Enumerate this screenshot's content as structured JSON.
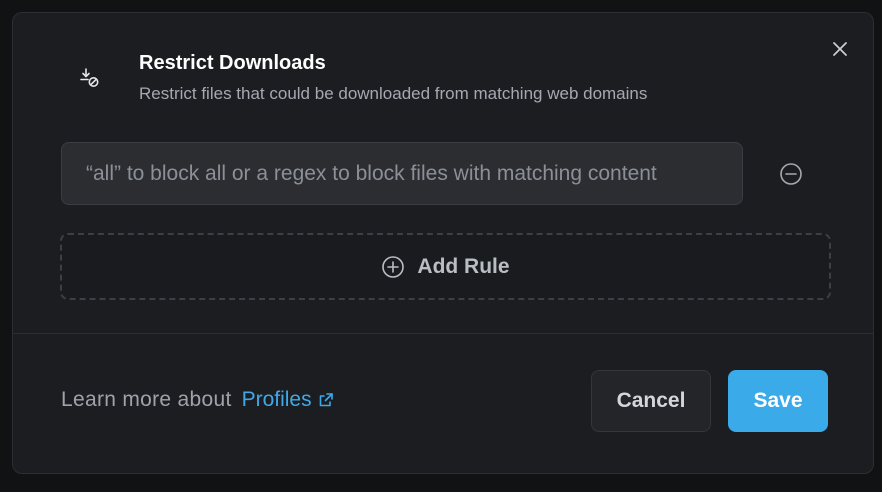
{
  "dialog": {
    "title": "Restrict Downloads",
    "subtitle": "Restrict files that could be downloaded from matching web domains",
    "icon": "download-blocked-icon"
  },
  "rule": {
    "placeholder": "“all” to block all or a regex to block files with matching content",
    "value": ""
  },
  "add_rule": {
    "label": "Add Rule",
    "icon": "plus-circle-icon"
  },
  "footer": {
    "learn_more_text": "Learn more about",
    "profiles_link": "Profiles",
    "link_icon": "external-link-icon",
    "cancel_label": "Cancel",
    "save_label": "Save"
  },
  "colors": {
    "accent": "#3aaae9",
    "link": "#3fa9e8",
    "modal_background": "#1c1d20",
    "page_background": "#111214"
  }
}
